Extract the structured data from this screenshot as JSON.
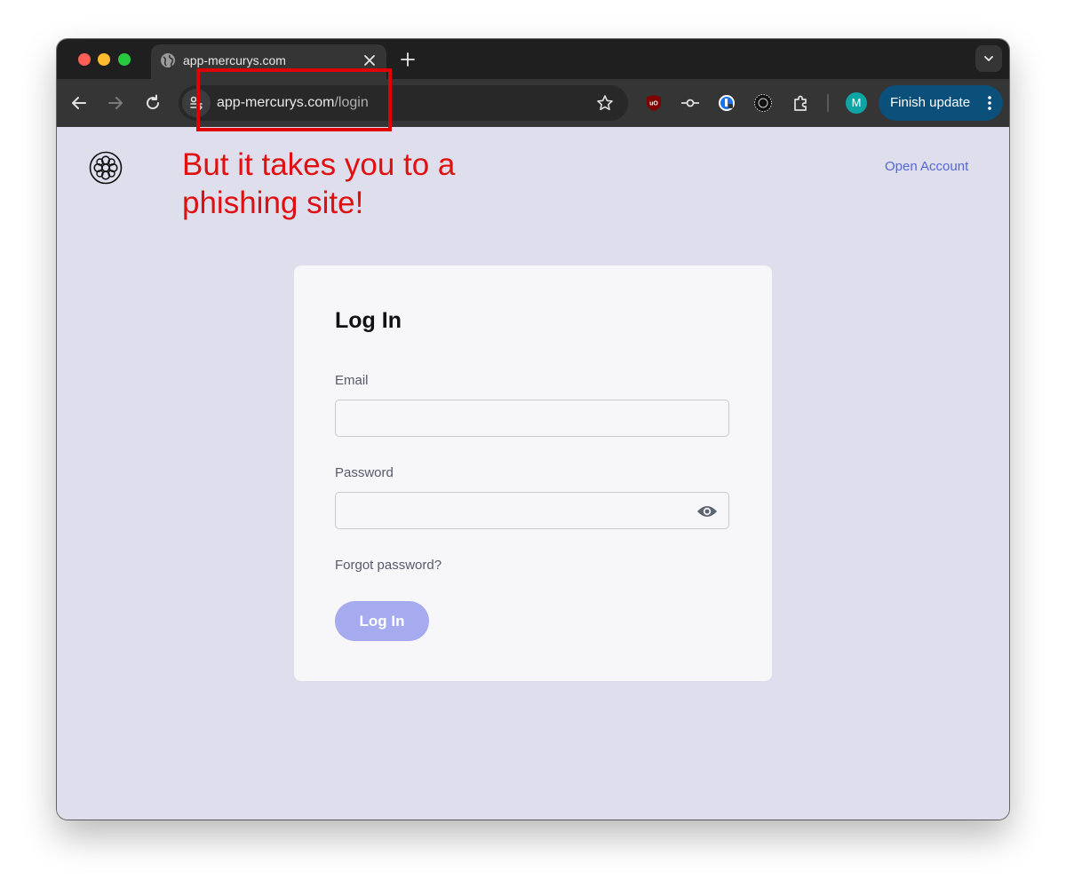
{
  "browser": {
    "tab_title": "app-mercurys.com",
    "url_domain": "app-mercurys.com",
    "url_path": "/login",
    "avatar_letter": "M",
    "finish_update_label": "Finish update"
  },
  "annotation": {
    "text": "But it takes you to a phishing site!",
    "color": "#e01010"
  },
  "page": {
    "open_account_link": "Open Account",
    "login_card": {
      "title": "Log In",
      "email_label": "Email",
      "email_value": "",
      "password_label": "Password",
      "password_value": "",
      "forgot_password": "Forgot password?",
      "submit_label": "Log In"
    }
  },
  "icons": [
    "globe-icon",
    "close-icon",
    "plus-icon",
    "chevron-down-icon",
    "back-arrow-icon",
    "forward-arrow-icon",
    "reload-icon",
    "site-info-icon",
    "star-icon",
    "ublock-icon",
    "commit-icon",
    "password-manager-icon",
    "sun-extension-icon",
    "puzzle-icon",
    "more-vertical-icon",
    "mercury-logo-icon",
    "eye-icon"
  ]
}
